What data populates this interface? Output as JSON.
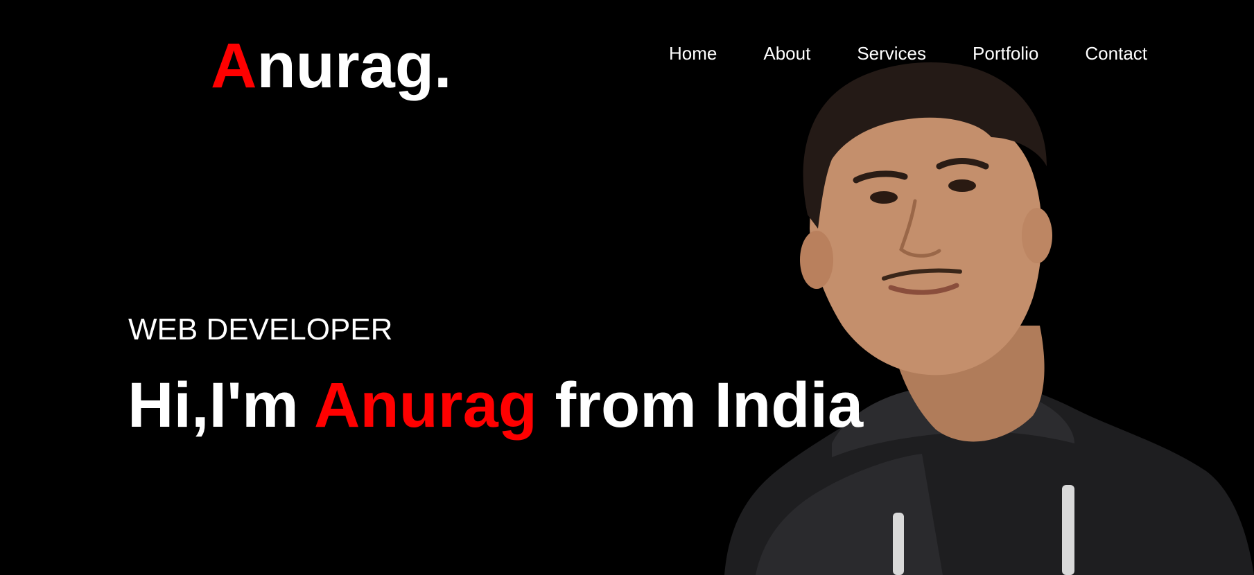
{
  "logo": {
    "initial": "A",
    "rest": "nurag."
  },
  "nav": {
    "items": [
      {
        "label": "Home"
      },
      {
        "label": "About"
      },
      {
        "label": "Services"
      },
      {
        "label": "Portfolio"
      },
      {
        "label": "Contact"
      }
    ]
  },
  "hero": {
    "subtitle": "WEB DEVELOPER",
    "headline_prefix": "Hi,I'm ",
    "headline_name": "Anurag",
    "headline_suffix": " from India"
  },
  "colors": {
    "background": "#000000",
    "accent": "#ff0000",
    "text": "#ffffff"
  }
}
